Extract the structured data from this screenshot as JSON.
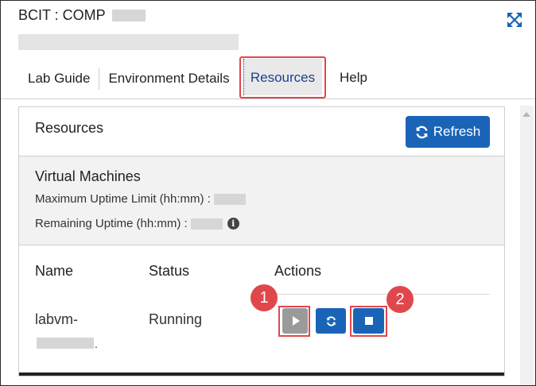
{
  "header": {
    "title": "BCIT : COMP"
  },
  "tabs": [
    {
      "label": "Lab Guide"
    },
    {
      "label": "Environment Details"
    },
    {
      "label": "Resources",
      "active": true
    },
    {
      "label": "Help"
    }
  ],
  "panel": {
    "title": "Resources",
    "refresh_label": "Refresh"
  },
  "vm_section": {
    "title": "Virtual Machines",
    "max_uptime_label": "Maximum Uptime Limit (hh:mm) :",
    "remaining_uptime_label": "Remaining Uptime (hh:mm) :"
  },
  "table": {
    "headers": {
      "name": "Name",
      "status": "Status",
      "actions": "Actions"
    },
    "rows": [
      {
        "name": "labvm-",
        "name_suffix": ".",
        "status": "Running"
      }
    ]
  },
  "callouts": [
    "1",
    "2"
  ],
  "icons": {
    "expand": "expand-icon",
    "refresh": "refresh-icon",
    "info": "info-icon",
    "play": "play-icon",
    "restart": "restart-icon",
    "stop": "stop-icon"
  },
  "colors": {
    "accent": "#1a64b8",
    "highlight": "#e0474c",
    "active_tab_text": "#1f3f8f"
  }
}
